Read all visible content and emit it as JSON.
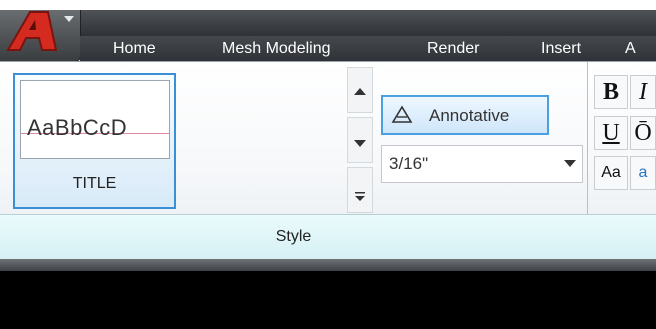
{
  "tabs": [
    "Home",
    "Mesh Modeling",
    "Render",
    "Insert",
    "A"
  ],
  "style_panel": {
    "preview_text": "AaBbCcD",
    "tile_label": "TITLE",
    "annotative_label": "Annotative",
    "text_height_value": "3/16\"",
    "panel_label": "Style"
  },
  "format_panel": {
    "bold_label": "B",
    "underline_label": "U",
    "overline_partial": "Ō",
    "italic_partial": "I",
    "case_label": "Aa",
    "case_partial": "a"
  },
  "colors": {
    "accent": "#3b8fd6",
    "app_logo": "#d42a20",
    "footer": "#dff5f8"
  }
}
